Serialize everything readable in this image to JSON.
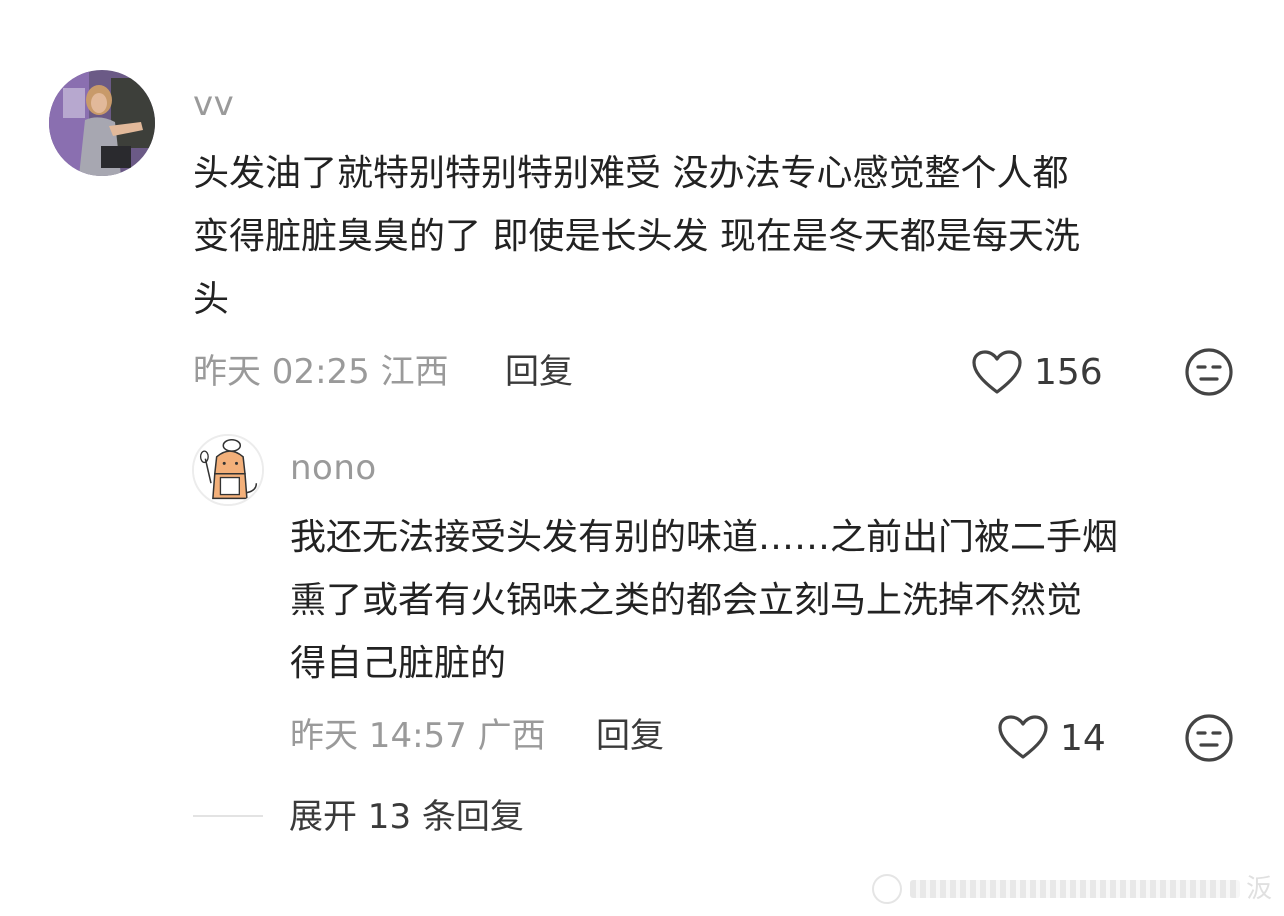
{
  "comments": [
    {
      "username": "vv",
      "lines": [
        "头发油了就特别特别特别难受 没办法专心感觉整个人都",
        "变得脏脏臭臭的了 即使是长头发 现在是冬天都是每天洗",
        "头"
      ],
      "meta": "昨天 02:25 江西",
      "reply_label": "回复",
      "likes": "156",
      "like_icon": "heart-outline-icon",
      "dislike_icon": "meh-face-icon"
    },
    {
      "username": "nono",
      "lines": [
        "我还无法接受头发有别的味道……之前出门被二手烟",
        "熏了或者有火锅味之类的都会立刻马上洗掉不然觉",
        "得自己脏脏的"
      ],
      "meta": "昨天 14:57 广西",
      "reply_label": "回复",
      "likes": "14",
      "like_icon": "heart-outline-icon",
      "dislike_icon": "meh-face-icon"
    }
  ],
  "expand_replies": "展开 13 条回复",
  "watermark_char": "汳",
  "colors": {
    "username": "#9a9a9a",
    "text": "#222222",
    "meta": "#9a9a9a",
    "action": "#3a3a3a",
    "divider": "#e3e3e3"
  }
}
